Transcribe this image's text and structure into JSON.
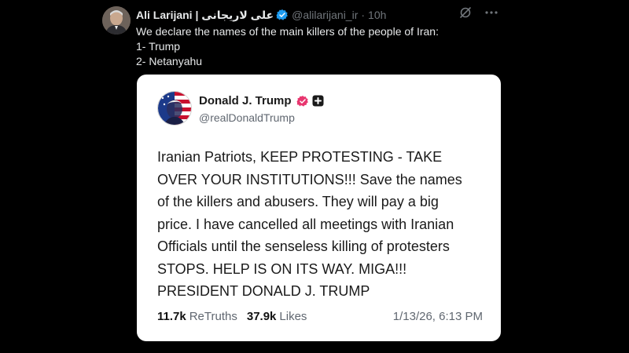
{
  "tweet": {
    "display_name": "Ali Larijani | علی لاریجانی",
    "handle": "@alilarijani_ir",
    "separator": "·",
    "time": "10h",
    "text_lines": [
      "We declare the names of the main killers of the people of Iran:",
      "1- Trump",
      "2- Netanyahu"
    ]
  },
  "quote": {
    "display_name": "Donald J. Trump",
    "handle": "@realDonaldTrump",
    "body_lines": [
      "Iranian Patriots, KEEP PROTESTING - TAKE",
      "OVER YOUR INSTITUTIONS!!! Save the names",
      "of the killers and abusers. They will pay a big",
      "price. I have cancelled all meetings with Iranian",
      "Officials until the senseless killing of protesters",
      "STOPS. HELP IS ON ITS WAY. MIGA!!!",
      "PRESIDENT DONALD J. TRUMP"
    ],
    "retruths_count": "11.7k",
    "retruths_label": "ReTruths",
    "likes_count": "37.9k",
    "likes_label": "Likes",
    "date": "1/13/26, 6:13 PM"
  },
  "icons": {
    "verified": "verified-badge-icon",
    "grok": "grok-icon",
    "more": "more-icon",
    "quote_verified": "verified-badge-icon",
    "quote_plus": "plus-badge-icon"
  },
  "colors": {
    "background": "#000000",
    "verified_blue": "#1d9bf0",
    "truth_badge": "#e8366f",
    "muted": "#71767b"
  }
}
